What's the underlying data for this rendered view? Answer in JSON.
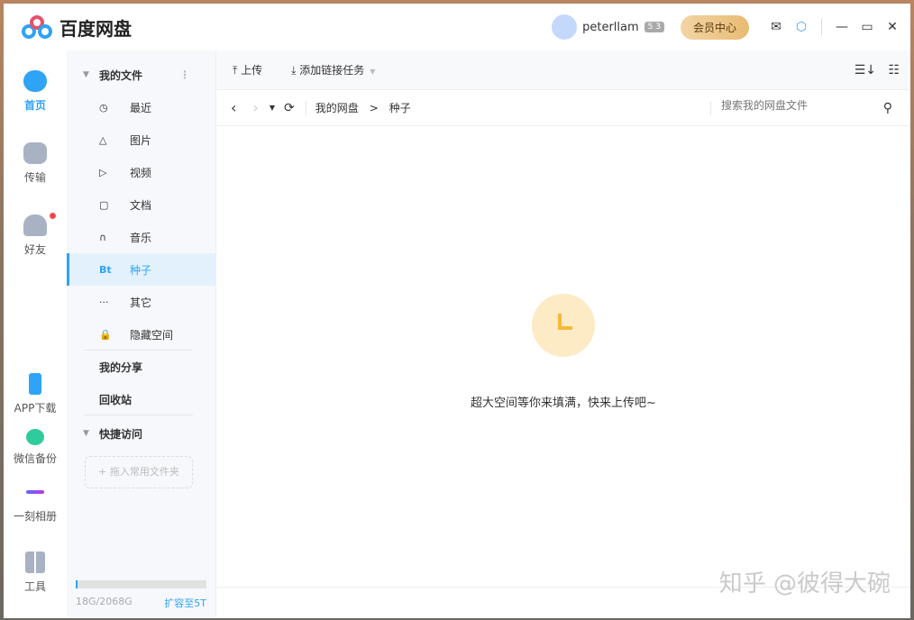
{
  "app": {
    "title": "百度网盘"
  },
  "user": {
    "name": "peterllam",
    "level": "5 3",
    "vip_button": "会员中心"
  },
  "nav": [
    {
      "label": "首页"
    },
    {
      "label": "传输"
    },
    {
      "label": "好友"
    },
    {
      "label": "APP下载"
    },
    {
      "label": "微信备份"
    },
    {
      "label": "一刻相册"
    },
    {
      "label": "工具"
    }
  ],
  "sidebar": {
    "my_files": "我的文件",
    "items": [
      {
        "icon": "◷",
        "label": "最近"
      },
      {
        "icon": "△",
        "label": "图片"
      },
      {
        "icon": "▷",
        "label": "视频"
      },
      {
        "icon": "▢",
        "label": "文档"
      },
      {
        "icon": "∩",
        "label": "音乐"
      },
      {
        "icon": "Bt",
        "label": "种子"
      },
      {
        "icon": "···",
        "label": "其它"
      },
      {
        "icon": "🔒",
        "label": "隐藏空间"
      }
    ],
    "my_share": "我的分享",
    "recycle": "回收站",
    "quick_access": "快捷访问",
    "drop_folder": "+ 拖入常用文件夹",
    "storage": "18G/2068G",
    "storage_fraction": 0.009,
    "expand": "扩容至5T"
  },
  "toolbar": {
    "upload": "上传",
    "add_link": "添加链接任务"
  },
  "breadcrumb": [
    "我的网盘",
    ">",
    "种子"
  ],
  "search": {
    "placeholder": "搜索我的网盘文件"
  },
  "empty": {
    "message": "超大空间等你来填满，快来上传吧~"
  },
  "watermark": "知乎 @彼得大碗"
}
